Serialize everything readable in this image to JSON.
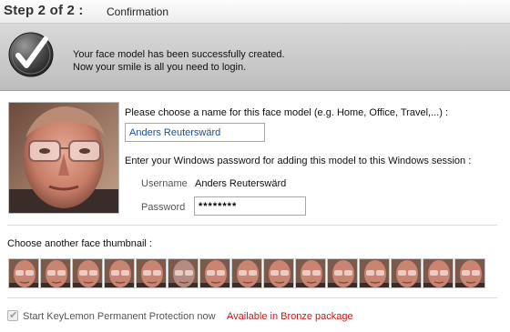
{
  "header": {
    "step": "Step 2 of 2 :",
    "subtitle": "Confirmation"
  },
  "banner": {
    "icon": "checkmark-icon",
    "line1": "Your face model has been successfully created.",
    "line2": "Now your smile is all you need to login."
  },
  "form": {
    "name_prompt": "Please choose a name for this face model (e.g. Home, Office, Travel,...) :",
    "name_value": "Anders Reuterswärd",
    "password_prompt": "Enter your Windows password for adding this model to this Windows session :",
    "username_label": "Username",
    "username_value": "Anders Reuterswärd",
    "password_label": "Password",
    "password_value": "********"
  },
  "thumbnails": {
    "label": "Choose another face thumbnail :",
    "count": 15
  },
  "protection": {
    "label": "Start KeyLemon Permanent Protection now",
    "checked": true,
    "note": "Available in Bronze package",
    "note_color": "#d21414"
  }
}
